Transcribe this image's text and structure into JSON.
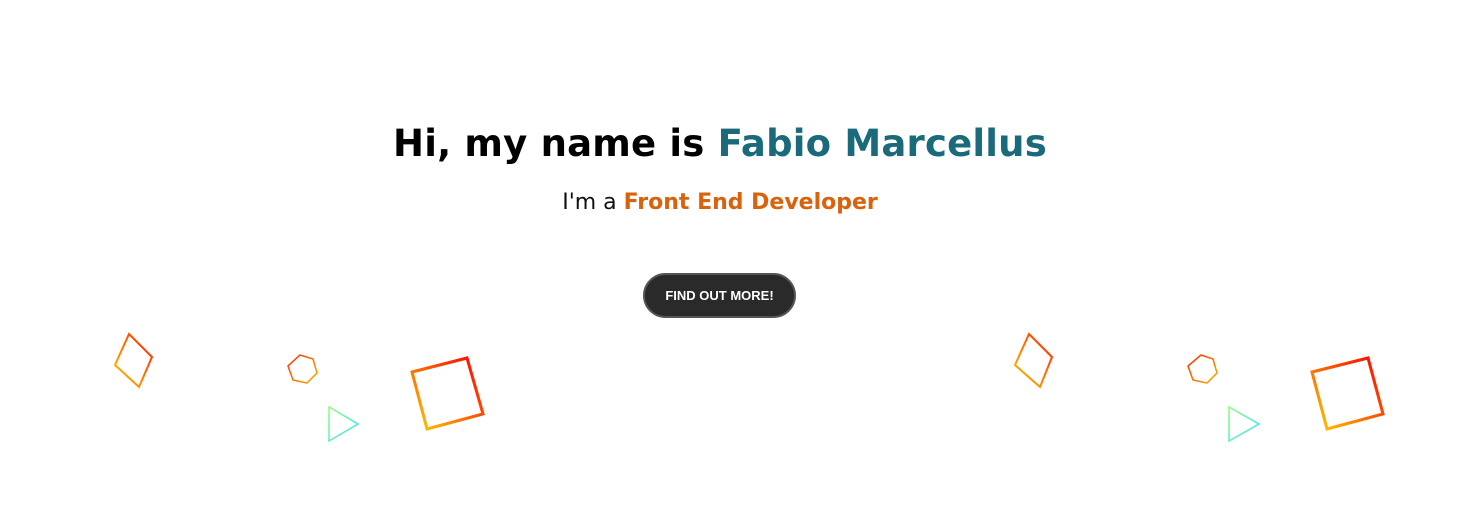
{
  "hero": {
    "greeting_prefix": "Hi, my name is ",
    "name": "Fabio Marcellus",
    "tagline_prefix": "I'm a ",
    "role": "Front End Developer",
    "cta_label": "FIND OUT MORE!"
  },
  "colors": {
    "name": "#1b6a7c",
    "role": "#d9620c",
    "button": "#2a2a2a"
  },
  "decor_icons": [
    "diamond-outline-icon",
    "hexagon-outline-icon",
    "triangle-outline-icon",
    "square-outline-icon"
  ]
}
